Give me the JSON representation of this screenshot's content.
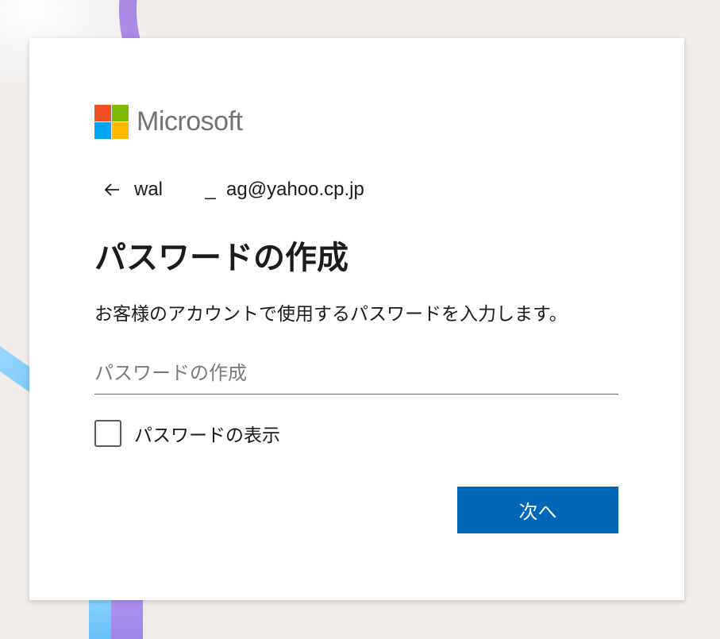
{
  "brand": {
    "name": "Microsoft",
    "colors": [
      "#f25022",
      "#7fba00",
      "#00a4ef",
      "#ffb900"
    ]
  },
  "identity": {
    "back_icon": "arrow-left-icon",
    "email": "wal        _  ag@yahoo.cp.jp"
  },
  "form": {
    "title": "パスワードの作成",
    "description": "お客様のアカウントで使用するパスワードを入力します。",
    "password_placeholder": "パスワードの作成",
    "password_value": "",
    "show_password_label": "パスワードの表示",
    "show_password_checked": false,
    "next_label": "次へ"
  },
  "theme": {
    "accent": "#0067b8",
    "text": "#1b1b1b",
    "background": "#efecea"
  }
}
